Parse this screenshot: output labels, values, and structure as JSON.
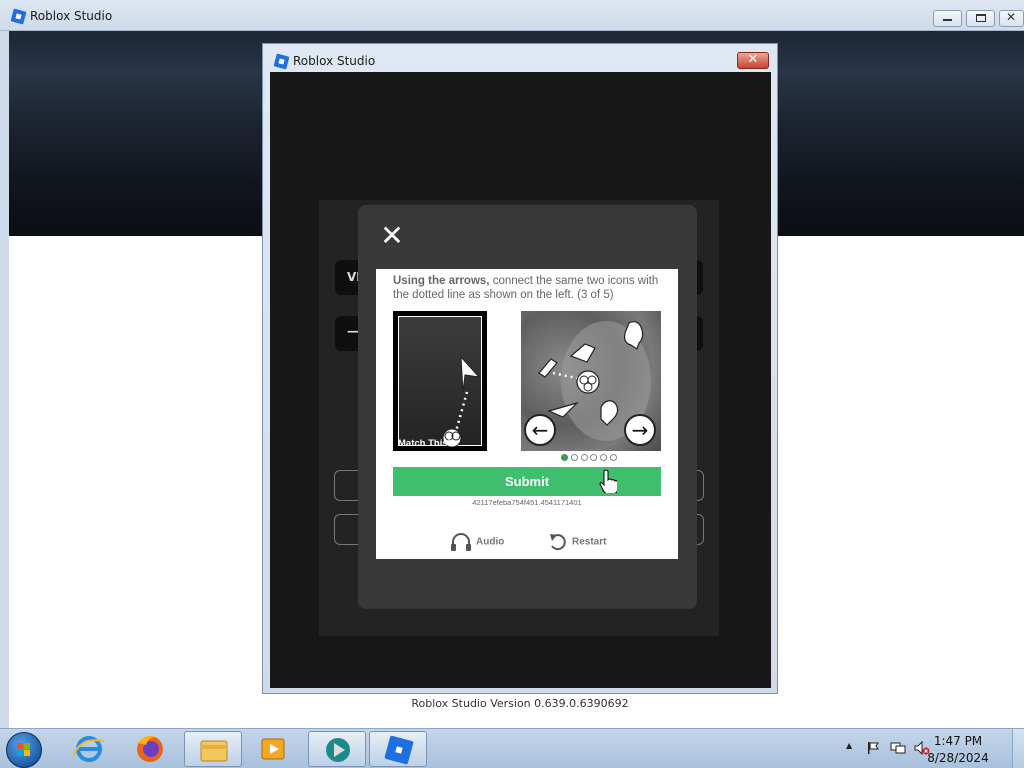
{
  "outer_window": {
    "title": "Roblox Studio",
    "minimize_symbol": "▭",
    "maximize_symbol": "▢",
    "close_symbol": "✕"
  },
  "dialog": {
    "title": "Roblox Studio",
    "close_symbol": "✕",
    "background_fragments": [
      "VI",
      "—"
    ]
  },
  "captcha": {
    "close_symbol": "✕",
    "instruction_bold": "Using the arrows,",
    "instruction_rest": " connect the same two icons with the dotted line as shown on the left. (3 of 5)",
    "match_label": "Match This!",
    "prev_arrow": "←",
    "next_arrow": "→",
    "dots_total": 6,
    "dots_active_index": 0,
    "submit_label": "Submit",
    "session_id": "42117efeba754f451.4541171401",
    "audio_label": "Audio",
    "restart_label": "Restart",
    "accent_color": "#3fbe6d"
  },
  "version_text": "Roblox Studio Version 0.639.0.6390692",
  "taskbar": {
    "apps": [
      "internet-explorer-icon",
      "firefox-icon",
      "file-explorer-icon",
      "media-player-icon",
      "app-icon",
      "roblox-studio-icon"
    ],
    "tray_chevron": "▲",
    "time": "1:47 PM",
    "date": "8/28/2024"
  }
}
